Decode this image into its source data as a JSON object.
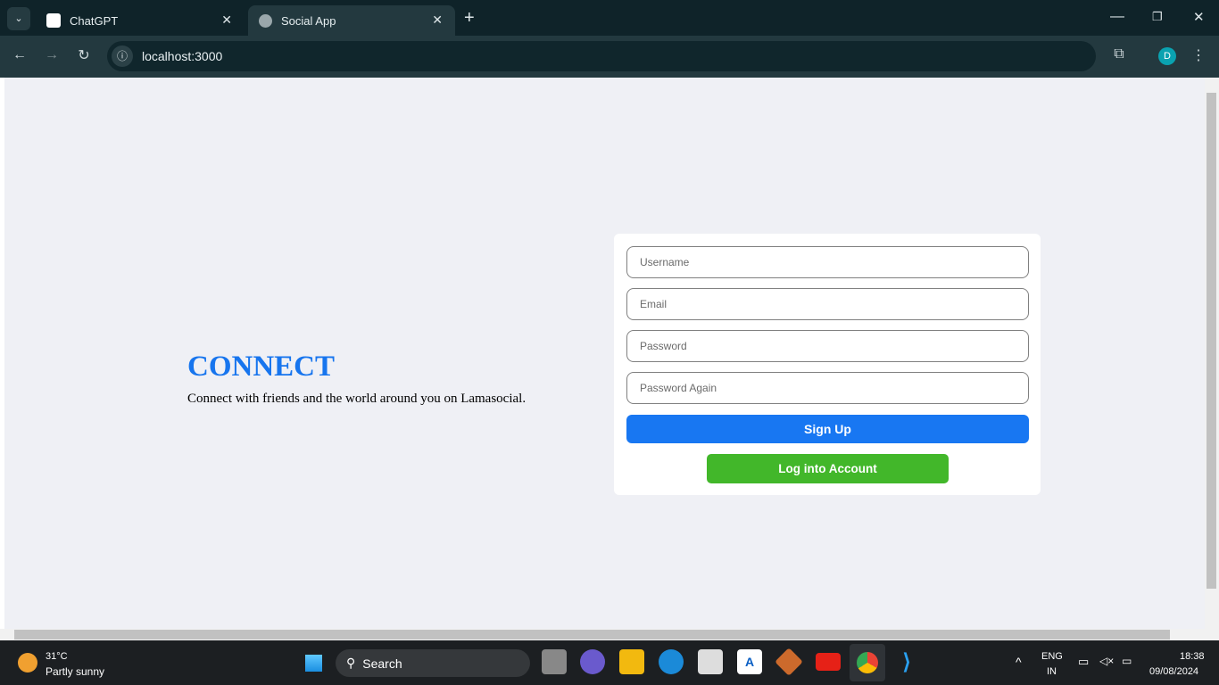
{
  "browser": {
    "tabs": [
      {
        "title": "ChatGPT",
        "active": false
      },
      {
        "title": "Social App",
        "active": true
      }
    ],
    "url": "localhost:3000",
    "profile_initial": "D"
  },
  "page": {
    "logo": "CONNECT",
    "description": "Connect with friends and the world around you on Lamasocial.",
    "form": {
      "username_placeholder": "Username",
      "email_placeholder": "Email",
      "password_placeholder": "Password",
      "password_again_placeholder": "Password Again",
      "signup_label": "Sign Up",
      "login_label": "Log into Account"
    },
    "colors": {
      "accent": "#1877f2",
      "login": "#42b72a",
      "logo": "#1775ee"
    }
  },
  "taskbar": {
    "weather_temp": "31°C",
    "weather_desc": "Partly sunny",
    "search_label": "Search",
    "lang_top": "ENG",
    "lang_bottom": "IN",
    "time": "18:38",
    "date": "09/08/2024"
  }
}
